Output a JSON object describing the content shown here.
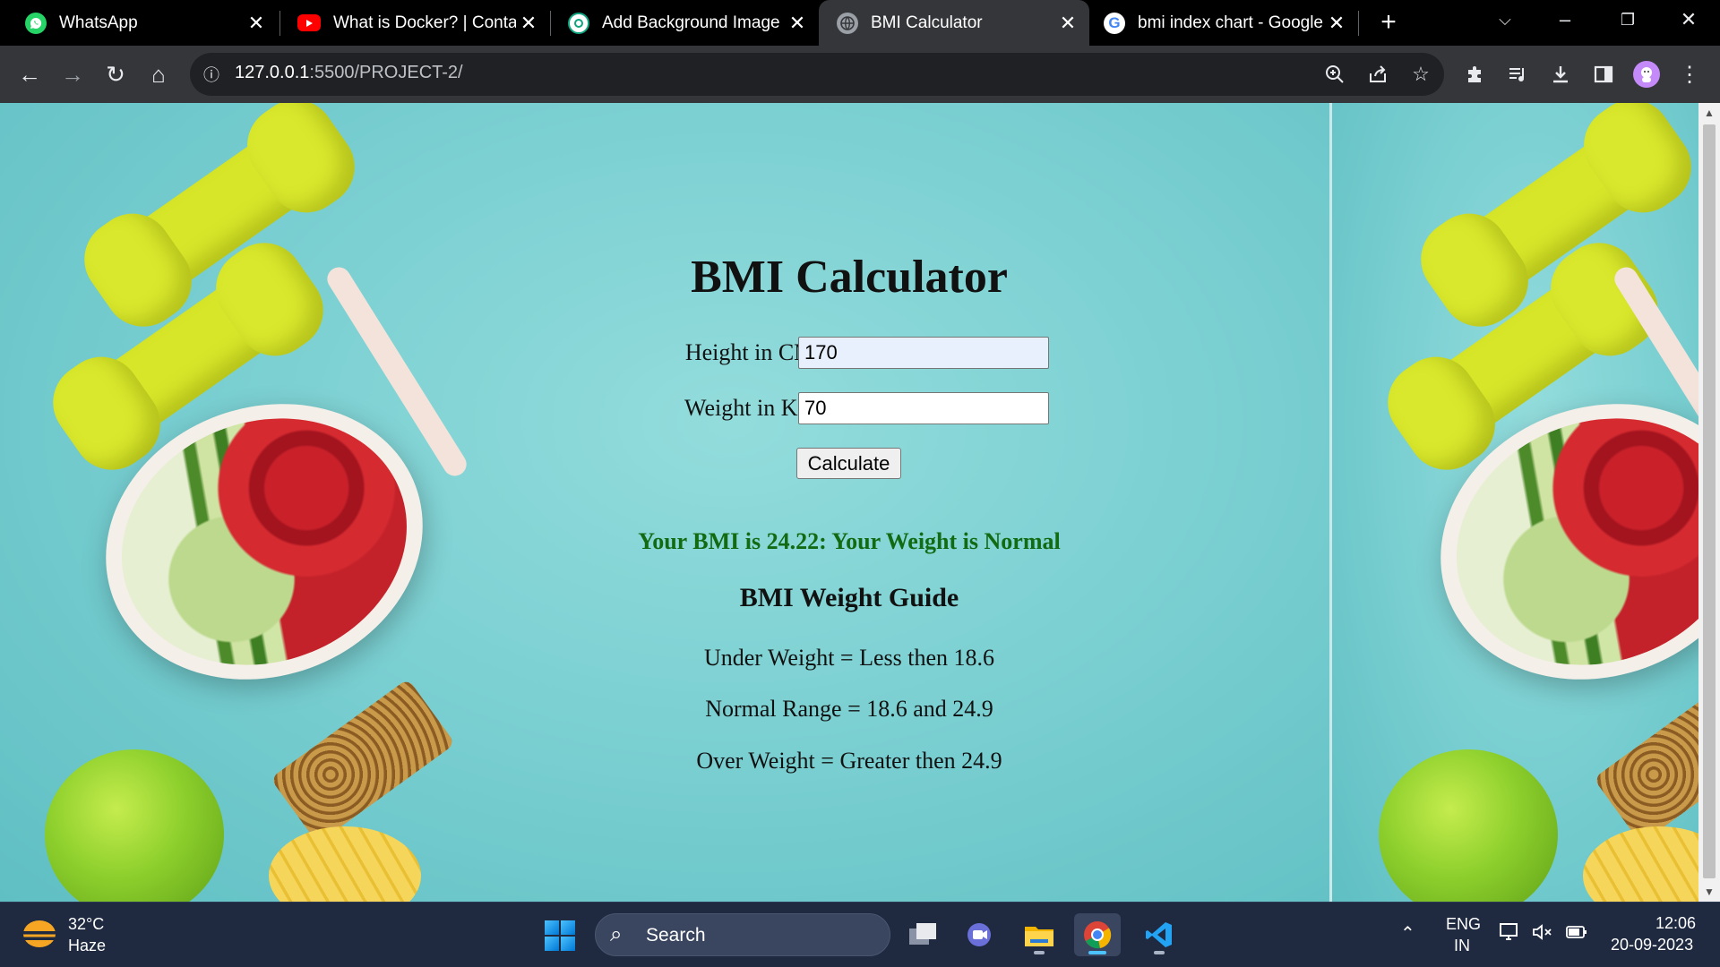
{
  "browser": {
    "tabs": [
      {
        "title": "WhatsApp",
        "icon": "whatsapp-icon",
        "active": false
      },
      {
        "title": "What is Docker? | Contain",
        "icon": "youtube-icon",
        "active": false
      },
      {
        "title": "Add Background Image ir",
        "icon": "chatgpt-icon",
        "active": false
      },
      {
        "title": "BMI Calculator",
        "icon": "globe-icon",
        "active": true
      },
      {
        "title": "bmi index chart - Google",
        "icon": "google-icon",
        "active": false
      }
    ],
    "url_host": "127.0.0.1",
    "url_rest": ":5500/PROJECT-2/"
  },
  "page": {
    "heading": "BMI Calculator",
    "height_label": "Height in CM :",
    "height_value": "170",
    "weight_label": "Weight in KG :",
    "weight_value": "70",
    "calculate_label": "Calculate",
    "result_text": "Your BMI is 24.22: Your Weight is Normal",
    "result_color": "#126b12",
    "guide_heading": "BMI Weight Guide",
    "guide_lines": [
      "Under Weight = Less then 18.6",
      "Normal Range = 18.6 and 24.9",
      "Over Weight = Greater then 24.9"
    ]
  },
  "taskbar": {
    "temperature": "32°C",
    "condition": "Haze",
    "search_label": "Search",
    "language": "ENG",
    "region": "IN",
    "time": "12:06",
    "date": "20-09-2023"
  }
}
